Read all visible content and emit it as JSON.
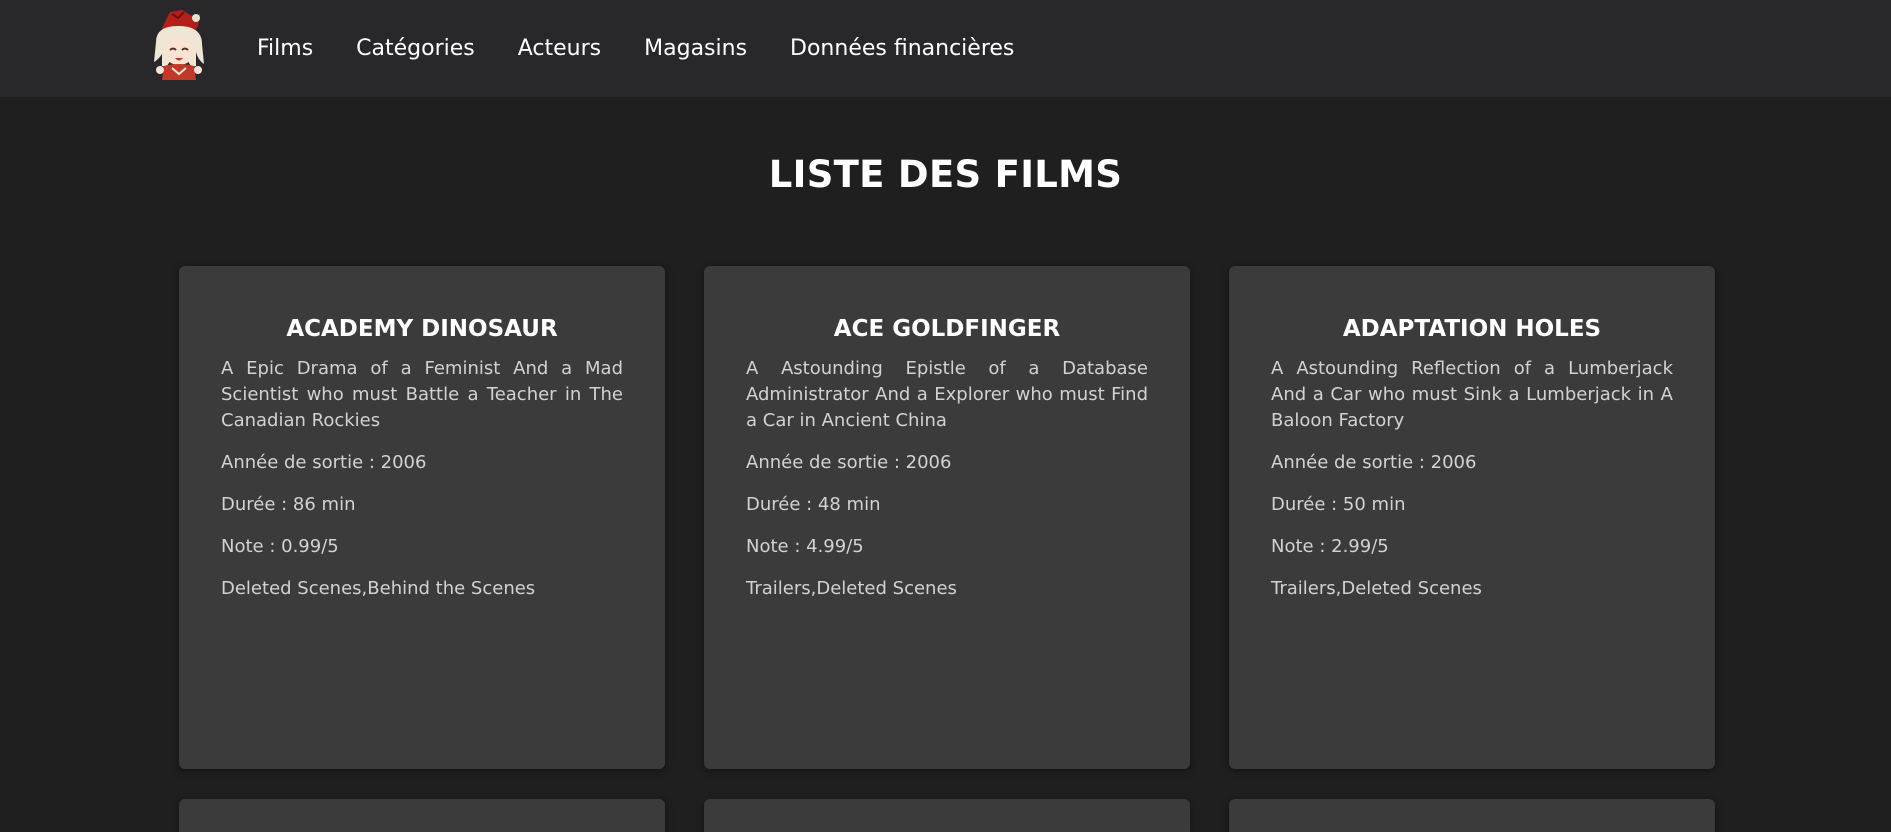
{
  "nav": {
    "logo_alt": "avatar logo",
    "links": [
      "Films",
      "Catégories",
      "Acteurs",
      "Magasins",
      "Données financières"
    ]
  },
  "page": {
    "title": "LISTE DES FILMS"
  },
  "films": [
    {
      "title": "ACADEMY DINOSAUR",
      "description": "A Epic Drama of a Feminist And a Mad Scientist who must Battle a Teacher in The Canadian Rockies",
      "year": "Année de sortie : 2006",
      "duration": "Durée : 86 min",
      "rating": "Note : 0.99/5",
      "features": "Deleted Scenes,Behind the Scenes"
    },
    {
      "title": "ACE GOLDFINGER",
      "description": "A Astounding Epistle of a Database Administrator And a Explorer who must Find a Car in Ancient China",
      "year": "Année de sortie : 2006",
      "duration": "Durée : 48 min",
      "rating": "Note : 4.99/5",
      "features": "Trailers,Deleted Scenes"
    },
    {
      "title": "ADAPTATION HOLES",
      "description": "A Astounding Reflection of a Lumberjack And a Car who must Sink a Lumberjack in A Baloon Factory",
      "year": "Année de sortie : 2006",
      "duration": "Durée : 50 min",
      "rating": "Note : 2.99/5",
      "features": "Trailers,Deleted Scenes"
    }
  ],
  "colors": {
    "background": "#1f1f1f",
    "navbar": "#28282b",
    "card": "#3b3b3c",
    "text_muted": "#d2d2d2"
  }
}
